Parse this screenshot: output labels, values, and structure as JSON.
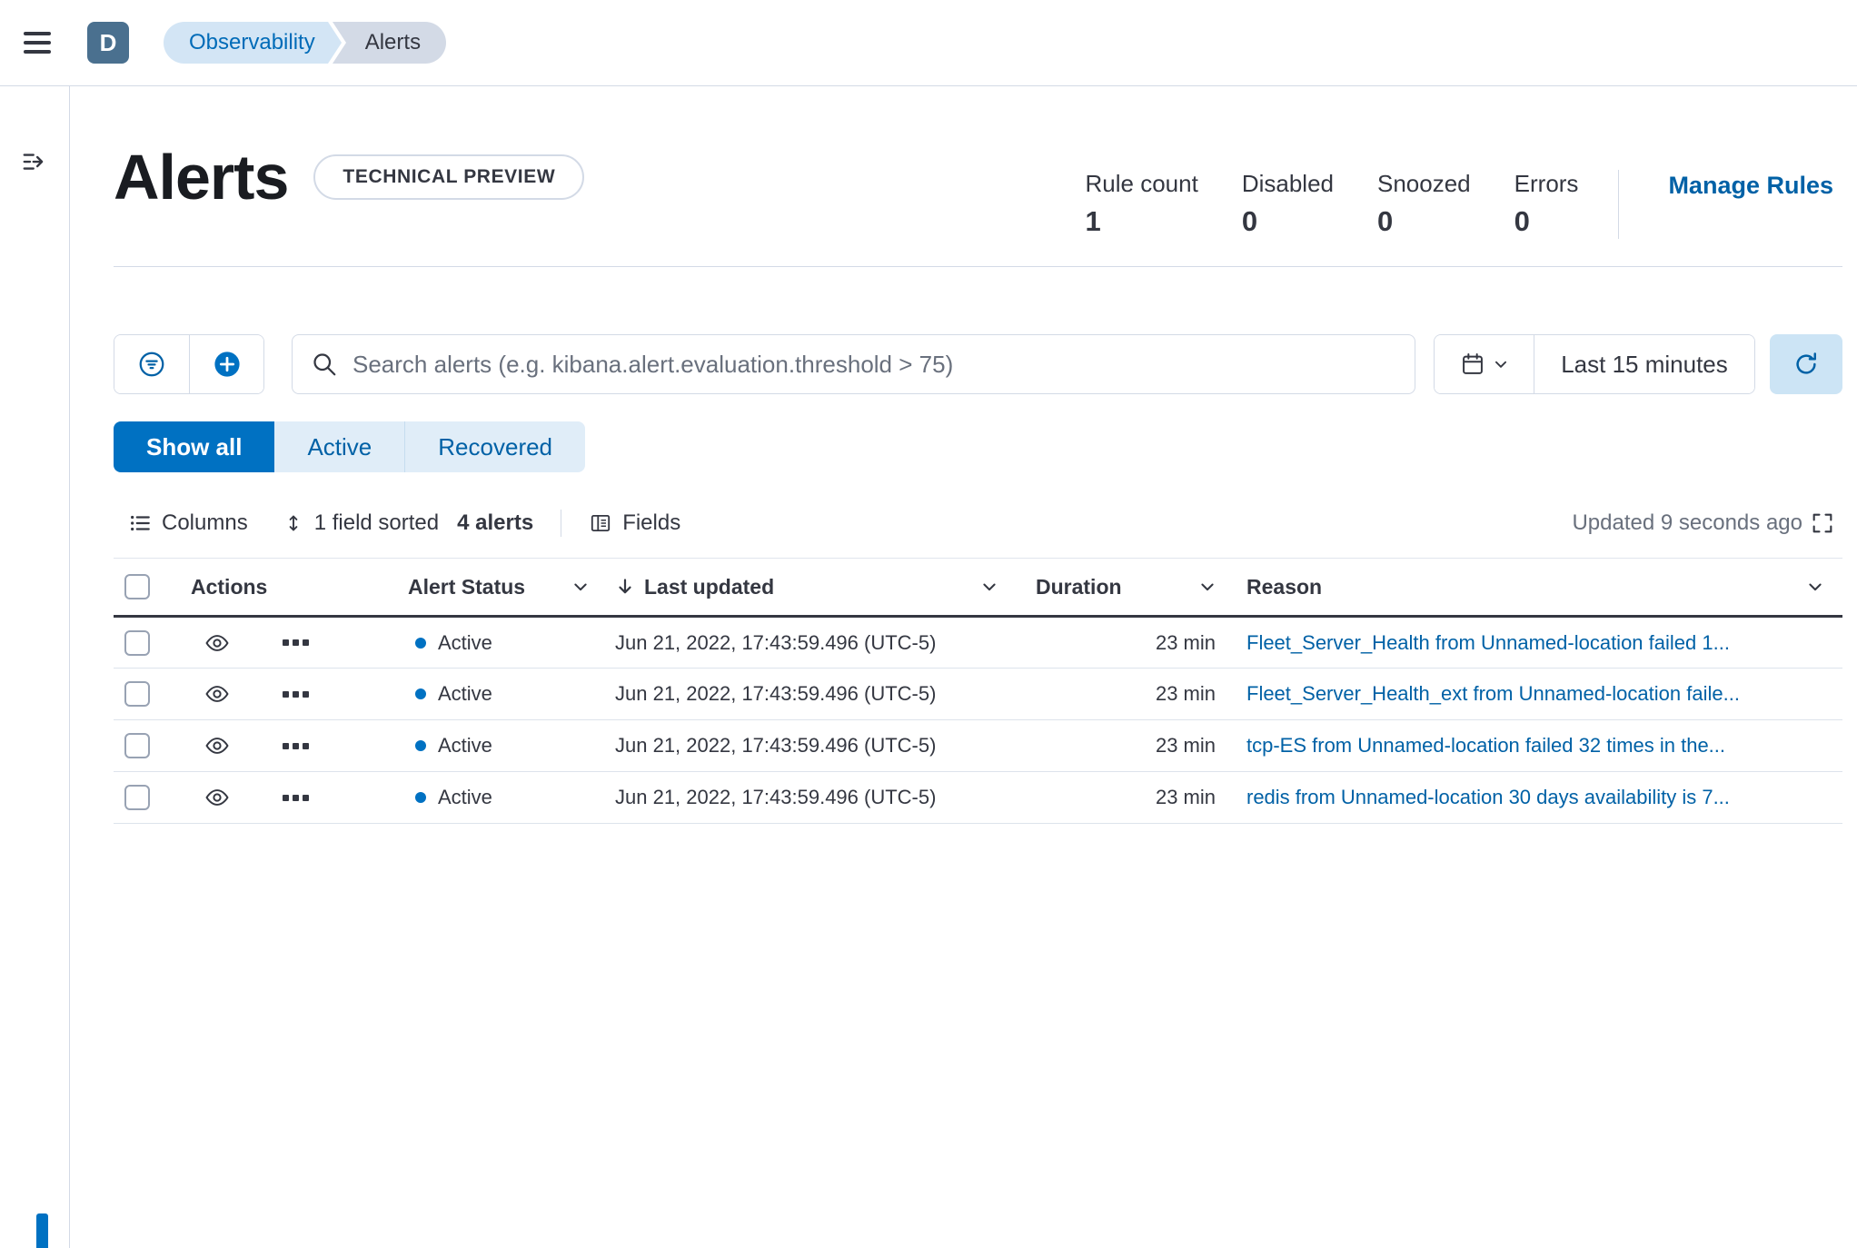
{
  "topbar": {
    "avatar": "D",
    "breadcrumbs": [
      {
        "label": "Observability"
      },
      {
        "label": "Alerts"
      }
    ]
  },
  "header": {
    "title": "Alerts",
    "badge": "TECHNICAL PREVIEW",
    "stats": [
      {
        "label": "Rule count",
        "value": "1"
      },
      {
        "label": "Disabled",
        "value": "0"
      },
      {
        "label": "Snoozed",
        "value": "0"
      },
      {
        "label": "Errors",
        "value": "0"
      }
    ],
    "manage_rules_label": "Manage Rules"
  },
  "search": {
    "placeholder": "Search alerts (e.g. kibana.alert.evaluation.threshold > 75)",
    "time_range": "Last 15 minutes"
  },
  "filters": [
    {
      "label": "Show all"
    },
    {
      "label": "Active"
    },
    {
      "label": "Recovered"
    }
  ],
  "toolbar": {
    "columns_label": "Columns",
    "sorted_label": "1 field sorted",
    "alerts_count": "4 alerts",
    "fields_label": "Fields",
    "updated_text": "Updated 9 seconds ago"
  },
  "table": {
    "headers": {
      "actions": "Actions",
      "status": "Alert Status",
      "last_updated": "Last updated",
      "duration": "Duration",
      "reason": "Reason"
    },
    "rows": [
      {
        "status": "Active",
        "last_updated": "Jun 21, 2022, 17:43:59.496 (UTC-5)",
        "duration": "23 min",
        "reason": "Fleet_Server_Health from Unnamed-location failed 1..."
      },
      {
        "status": "Active",
        "last_updated": "Jun 21, 2022, 17:43:59.496 (UTC-5)",
        "duration": "23 min",
        "reason": "Fleet_Server_Health_ext from Unnamed-location faile..."
      },
      {
        "status": "Active",
        "last_updated": "Jun 21, 2022, 17:43:59.496 (UTC-5)",
        "duration": "23 min",
        "reason": "tcp-ES from Unnamed-location failed 32 times in the..."
      },
      {
        "status": "Active",
        "last_updated": "Jun 21, 2022, 17:43:59.496 (UTC-5)",
        "duration": "23 min",
        "reason": "redis from Unnamed-location 30 days availability is 7..."
      }
    ]
  },
  "colors": {
    "primary": "#0071c2",
    "link": "#0061a6",
    "text": "#343741",
    "text_subdued": "#69707d",
    "border": "#d3dae6",
    "avatar_bg": "#4a708f",
    "breadcrumb_active_bg": "#d3e5f5",
    "breadcrumb_bg": "#d3dae6",
    "segment_light_bg": "#e0edf8",
    "refresh_bg": "#cce4f5",
    "status_dot": "#0071c2"
  }
}
